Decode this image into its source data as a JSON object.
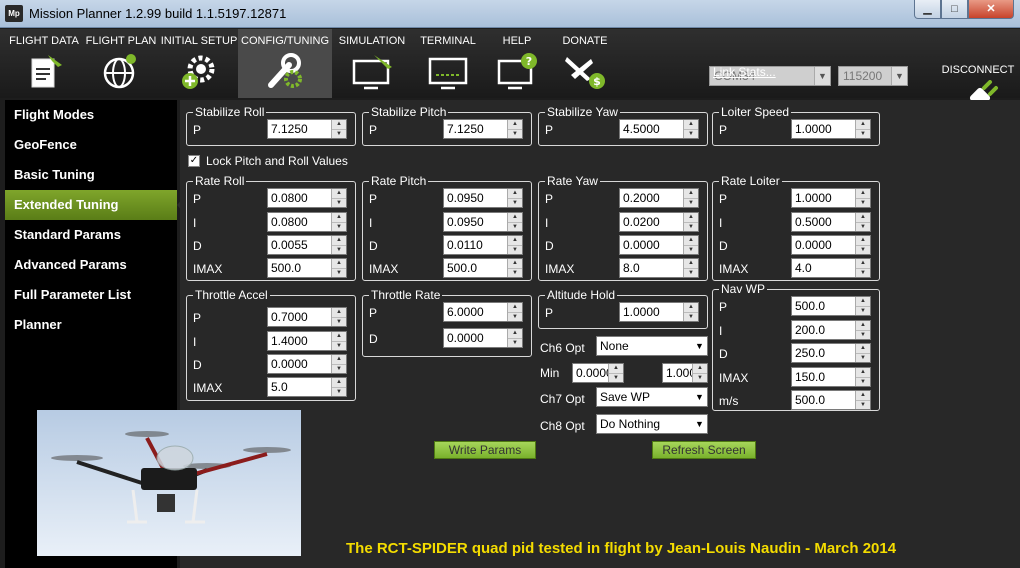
{
  "window": {
    "title": "Mission Planner 1.2.99 build 1.1.5197.12871",
    "app_icon": "Mp"
  },
  "menu": {
    "items": [
      {
        "label": "FLIGHT DATA",
        "icon": "clipboard-plane-icon"
      },
      {
        "label": "FLIGHT PLAN",
        "icon": "globe-icon"
      },
      {
        "label": "INITIAL SETUP",
        "icon": "gear-plus-icon"
      },
      {
        "label": "CONFIG/TUNING",
        "icon": "wrench-gear-icon"
      },
      {
        "label": "SIMULATION",
        "icon": "monitor-plane-icon"
      },
      {
        "label": "TERMINAL",
        "icon": "monitor-terminal-icon"
      },
      {
        "label": "HELP",
        "icon": "monitor-help-icon"
      },
      {
        "label": "DONATE",
        "icon": "plane-dollar-icon"
      }
    ],
    "port": "COM34",
    "baud": "115200",
    "link_stats": "Link Stats...",
    "disconnect": "DISCONNECT"
  },
  "sidebar": {
    "items": [
      "Flight Modes",
      "GeoFence",
      "Basic Tuning",
      "Extended Tuning",
      "Standard Params",
      "Advanced Params",
      "Full Parameter List",
      "Planner"
    ],
    "active": "Extended Tuning"
  },
  "groups": {
    "stabilize_roll": {
      "title": "Stabilize Roll",
      "p_label": "P",
      "p": "7.1250"
    },
    "stabilize_pitch": {
      "title": "Stabilize Pitch",
      "p_label": "P",
      "p": "7.1250"
    },
    "stabilize_yaw": {
      "title": "Stabilize Yaw",
      "p_label": "P",
      "p": "4.5000"
    },
    "loiter_speed": {
      "title": "Loiter Speed",
      "p_label": "P",
      "p": "1.0000"
    },
    "rate_roll": {
      "title": "Rate Roll",
      "p_label": "P",
      "i_label": "I",
      "d_label": "D",
      "imax_label": "IMAX",
      "p": "0.0800",
      "i": "0.0800",
      "d": "0.0055",
      "imax": "500.0"
    },
    "rate_pitch": {
      "title": "Rate Pitch",
      "p_label": "P",
      "i_label": "I",
      "d_label": "D",
      "imax_label": "IMAX",
      "p": "0.0950",
      "i": "0.0950",
      "d": "0.0110",
      "imax": "500.0"
    },
    "rate_yaw": {
      "title": "Rate Yaw",
      "p_label": "P",
      "i_label": "I",
      "d_label": "D",
      "imax_label": "IMAX",
      "p": "0.2000",
      "i": "0.0200",
      "d": "0.0000",
      "imax": "8.0"
    },
    "rate_loiter": {
      "title": "Rate Loiter",
      "p_label": "P",
      "i_label": "I",
      "d_label": "D",
      "imax_label": "IMAX",
      "p": "1.0000",
      "i": "0.5000",
      "d": "0.0000",
      "imax": "4.0"
    },
    "throttle_accel": {
      "title": "Throttle Accel",
      "p_label": "P",
      "i_label": "I",
      "d_label": "D",
      "imax_label": "IMAX",
      "p": "0.7000",
      "i": "1.4000",
      "d": "0.0000",
      "imax": "5.0"
    },
    "throttle_rate": {
      "title": "Throttle Rate",
      "p_label": "P",
      "d_label": "D",
      "p": "6.0000",
      "d": "0.0000"
    },
    "altitude_hold": {
      "title": "Altitude Hold",
      "p_label": "P",
      "p": "1.0000"
    },
    "nav_wp": {
      "title": "Nav WP",
      "p_label": "P",
      "i_label": "I",
      "d_label": "D",
      "imax_label": "IMAX",
      "ms_label": "m/s",
      "p": "500.0",
      "i": "200.0",
      "d": "250.0",
      "imax": "150.0",
      "ms": "500.0"
    }
  },
  "lock_pitch_roll": {
    "label": "Lock Pitch and Roll Values",
    "checked": "✓"
  },
  "options": {
    "ch6_label": "Ch6 Opt",
    "ch6": "None",
    "min_label": "Min",
    "min": "0.0000",
    "max": "1.000",
    "ch7_label": "Ch7 Opt",
    "ch7": "Save WP",
    "ch8_label": "Ch8 Opt",
    "ch8": "Do Nothing"
  },
  "buttons": {
    "write": "Write Params",
    "refresh": "Refresh Screen"
  },
  "caption": "The RCT-SPIDER quad pid tested in flight by Jean-Louis Naudin - March 2014",
  "colors": {
    "accent_green": "#7fa52b",
    "caption_yellow": "#f4dc00"
  }
}
